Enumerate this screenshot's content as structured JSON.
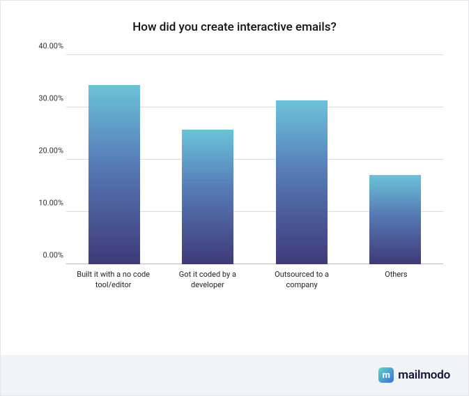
{
  "chart_data": {
    "type": "bar",
    "title": "How did you create interactive emails?",
    "categories": [
      "Built it with a no code tool/editor",
      "Got it coded by a developer",
      "Outsourced to a company",
      "Others"
    ],
    "values": [
      34.3,
      25.7,
      31.4,
      17.1
    ],
    "ylabel": "",
    "xlabel": "",
    "ylim": [
      0,
      40
    ],
    "yticks": [
      0,
      10,
      20,
      30,
      40
    ],
    "ytick_labels": [
      "0.00%",
      "10.00%",
      "20.00%",
      "30.00%",
      "40.00%"
    ]
  },
  "branding": {
    "name": "mailmodo",
    "mark_glyph": "m"
  }
}
